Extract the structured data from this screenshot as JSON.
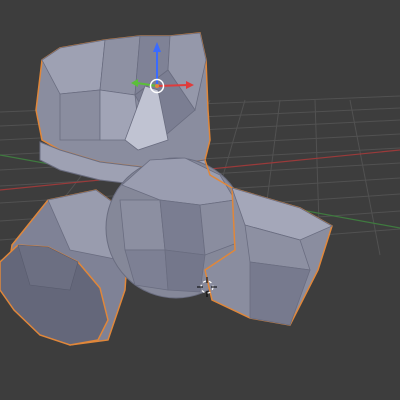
{
  "viewport": {
    "background": "#3d3d3d",
    "grid_color": "#555555",
    "x_axis_color": "#9a3a3a",
    "y_axis_color": "#3f7a3f"
  },
  "object": {
    "fill": "#8a8d9f",
    "fill_dark": "#6e7183",
    "fill_light": "#a7aabb",
    "selection_outline": "#e0873a",
    "wire_color": "#5f6274"
  },
  "gizmo": {
    "x_color": "#e03b3b",
    "y_color": "#5bbf39",
    "z_color": "#3a6bff",
    "center_ring_color": "#ffffff"
  },
  "icons": {
    "origin_dot": "origin-dot-icon",
    "cursor": "3d-cursor-icon"
  }
}
